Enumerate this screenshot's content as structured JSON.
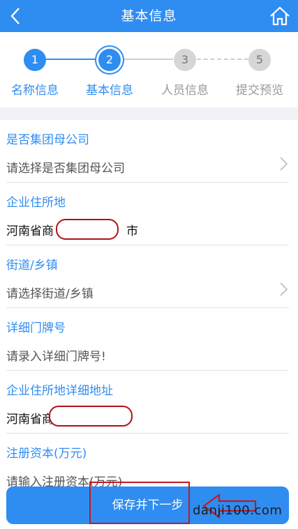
{
  "header": {
    "title": "基本信息",
    "bg_color": "#2f8df1"
  },
  "steps": [
    {
      "number": "1",
      "label": "名称信息",
      "state": "done"
    },
    {
      "number": "2",
      "label": "基本信息",
      "state": "current"
    },
    {
      "number": "3",
      "label": "人员信息",
      "state": "todo"
    },
    {
      "number": "5",
      "label": "提交预览",
      "state": "todo"
    }
  ],
  "form": {
    "group_parent": {
      "label": "是否集团母公司",
      "placeholder": "请选择是否集团母公司"
    },
    "residence": {
      "label": "企业住所地",
      "value_prefix": "河南省商",
      "value_suffix": "市"
    },
    "street": {
      "label": "街道/乡镇",
      "placeholder": "请选择街道/乡镇"
    },
    "door_number": {
      "label": "详细门牌号",
      "placeholder": "请录入详细门牌号!"
    },
    "detail_address": {
      "label": "企业住所地详细地址",
      "value_prefix": "河南省商"
    },
    "capital": {
      "label": "注册资本(万元)",
      "placeholder": "请输入注册资本(万元)"
    }
  },
  "save_button": {
    "label": "保存并下一步"
  },
  "watermark": "danji100.com",
  "colors": {
    "accent": "#2f8df1",
    "annotation": "#c01a22",
    "inactive_step": "#d0d0d0"
  }
}
